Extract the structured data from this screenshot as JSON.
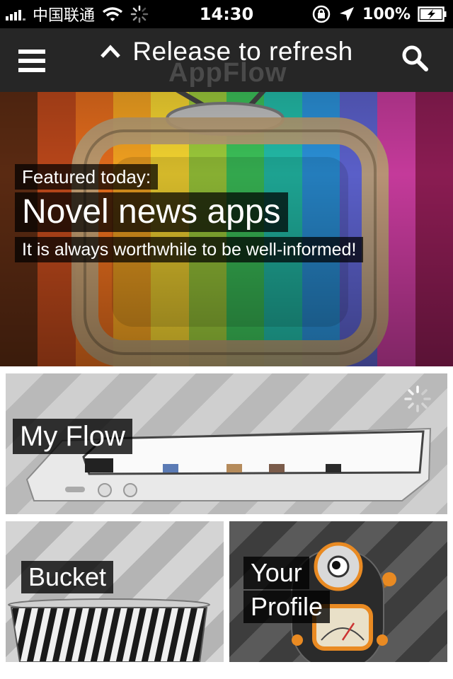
{
  "status_bar": {
    "carrier": "中国联通",
    "time": "14:30",
    "battery": "100%"
  },
  "header": {
    "pull_text": "Release to refresh",
    "logo_text": "AppFlow",
    "menu_icon": "hamburger-menu-icon",
    "search_icon": "search-icon"
  },
  "hero": {
    "eyebrow": "Featured today:",
    "title": "Novel news apps",
    "subtitle": "It is always worthwhile to be well-informed!",
    "stripe_colors": [
      "#5a2a12",
      "#b8461a",
      "#e06a1c",
      "#f0a020",
      "#f2d230",
      "#9ac83a",
      "#3bbf58",
      "#22b9a6",
      "#2a8fd6",
      "#5a5fc8",
      "#c43a9a",
      "#8a1c52"
    ]
  },
  "tiles": {
    "my_flow": "My Flow",
    "bucket": "Bucket",
    "your_profile_line1": "Your",
    "your_profile_line2": "Profile"
  }
}
